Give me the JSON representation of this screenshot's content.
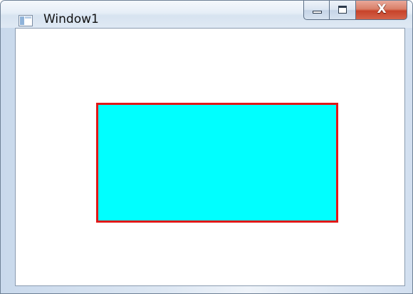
{
  "window": {
    "title": "Window1",
    "icon": "app-window-icon",
    "caption_buttons": {
      "minimize_icon": "minimize-icon",
      "maximize_icon": "maximize-icon",
      "close_icon": "close-icon",
      "close_glyph": "X"
    }
  },
  "canvas": {
    "rectangle": {
      "fill": "#00ffff",
      "stroke": "#e01818"
    }
  }
}
